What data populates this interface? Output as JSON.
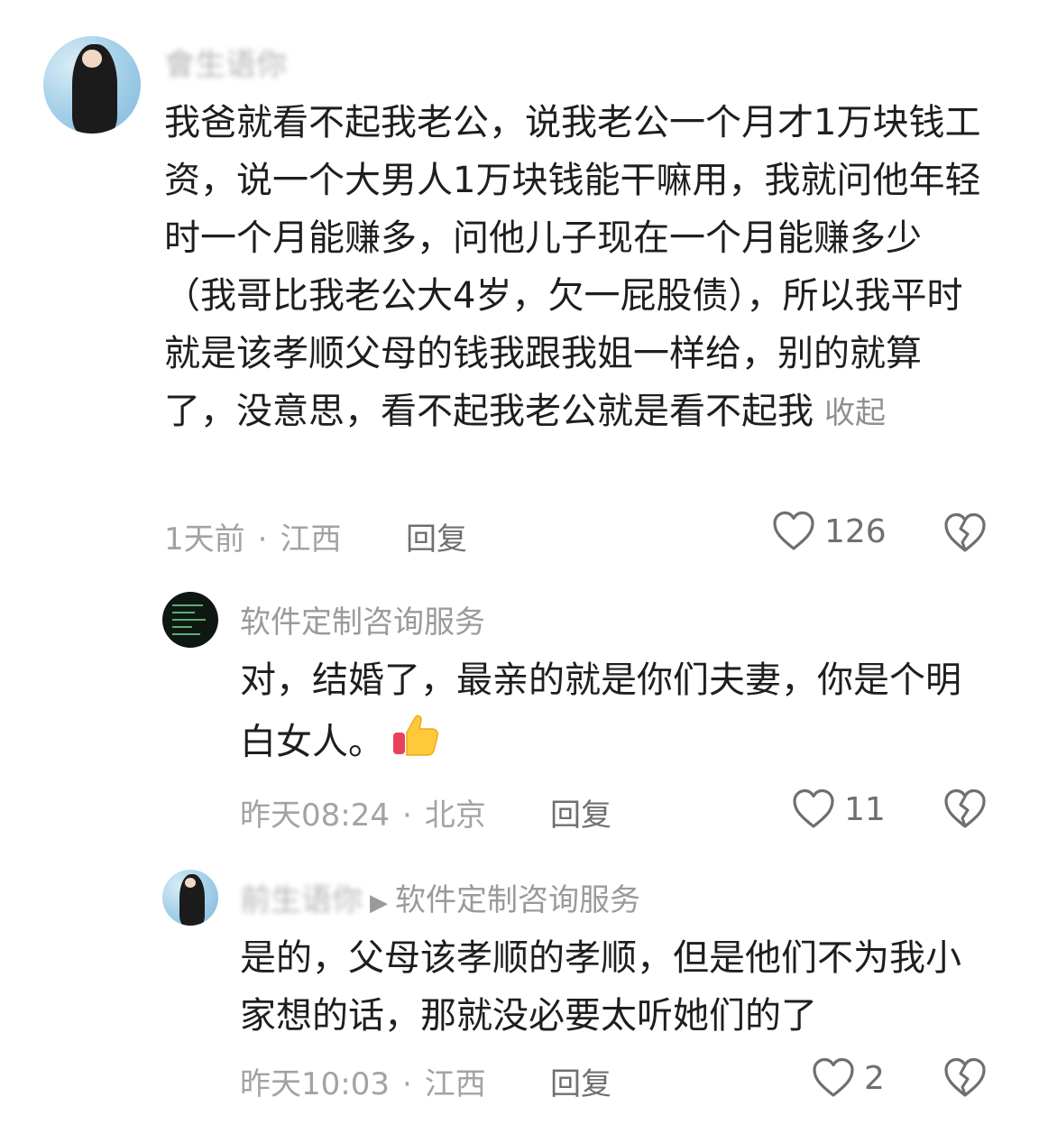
{
  "comments": [
    {
      "username": "會生语你",
      "text": "我爸就看不起我老公，说我老公一个月才1万块钱工资，说一个大男人1万块钱能干嘛用，我就问他年轻时一个月能赚多，问他儿子现在一个月能赚多少（我哥比我老公大4岁，欠一屁股债），所以我平时就是该孝顺父母的钱我跟我姐一样给，别的就算了，没意思，看不起我老公就是看不起我",
      "collapse_label": "收起",
      "time": "1天前",
      "location": "江西",
      "reply_label": "回复",
      "likes": "126"
    },
    {
      "username": "软件定制咨询服务",
      "text": "对，结婚了，最亲的就是你们夫妻，你是个明白女人。",
      "emoji": "thumbs-up-icon",
      "time": "昨天08:24",
      "location": "北京",
      "reply_label": "回复",
      "likes": "11"
    },
    {
      "username": "前生语你",
      "reply_to": "软件定制咨询服务",
      "text": "是的，父母该孝顺的孝顺，但是他们不为我小家想的话，那就没必要太听她们的了",
      "time": "昨天10:03",
      "location": "江西",
      "reply_label": "回复",
      "likes": "2"
    }
  ],
  "separator": "·",
  "icons": {
    "like": "heart-outline-icon",
    "dislike": "broken-heart-icon"
  },
  "colors": {
    "text": "#1e1e1e",
    "meta": "#a3a3a3",
    "icon": "#6f6f6f"
  }
}
